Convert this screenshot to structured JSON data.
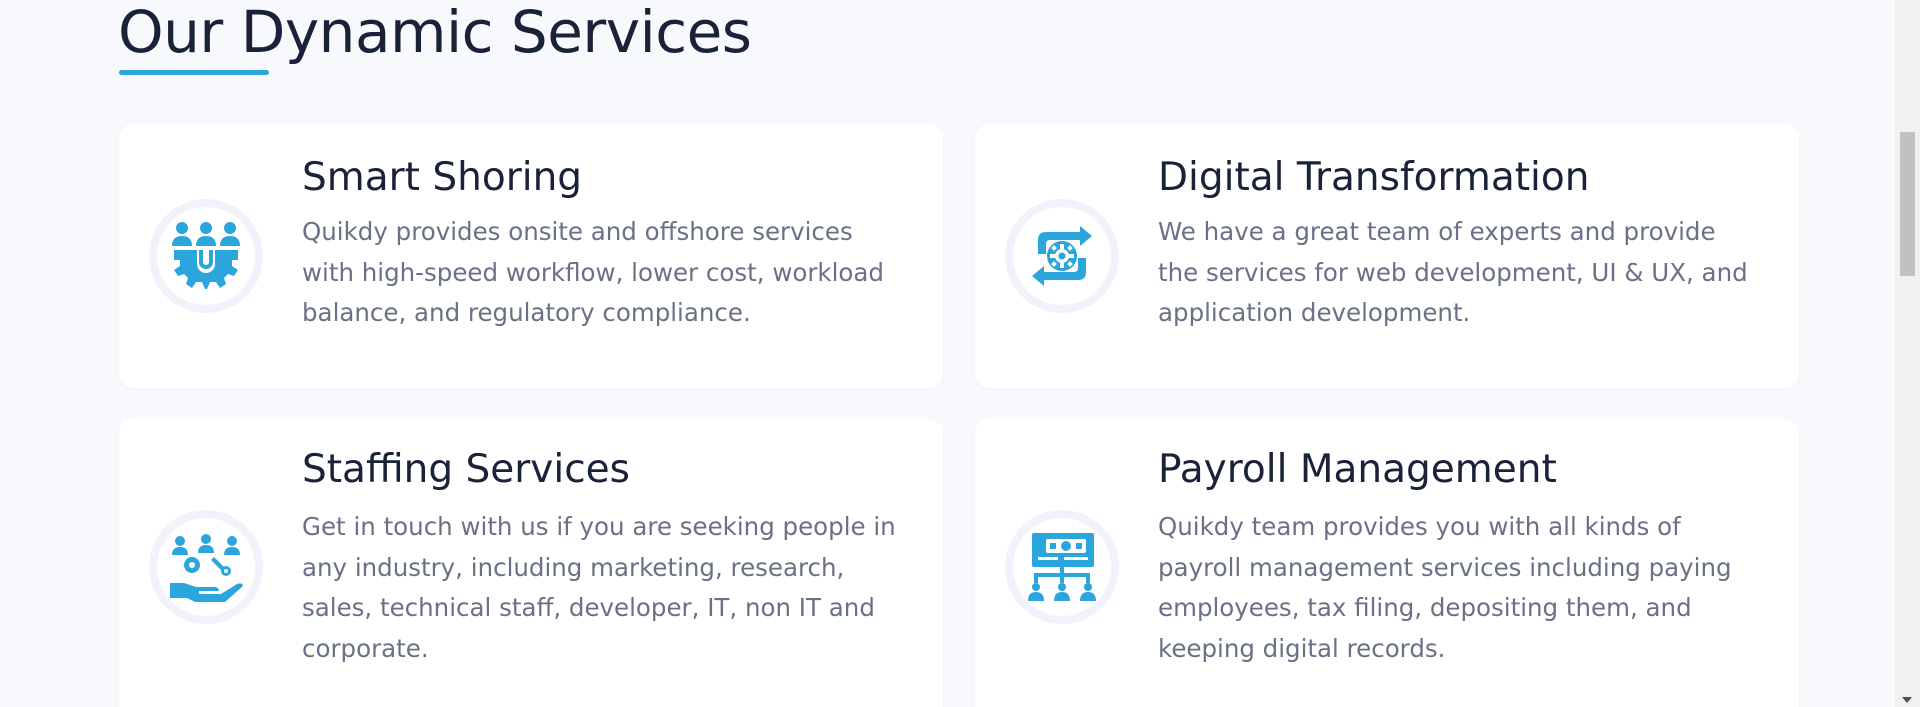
{
  "section": {
    "heading": "Our Dynamic Services"
  },
  "colors": {
    "accent": "#2aa6dc",
    "heading": "#1a2239",
    "body_text": "#6a7186",
    "background": "#f8f9fd",
    "card": "#ffffff"
  },
  "services": [
    {
      "title": "Smart Shoring",
      "description": "Quikdy provides onsite and offshore services with high-speed workflow, lower cost, workload balance, and regulatory compliance.",
      "icon": "team-gear-icon"
    },
    {
      "title": "Digital Transformation",
      "description": "We have a great team of experts and provide the services for web development, UI & UX, and application development.",
      "icon": "transform-gear-icon"
    },
    {
      "title": "Staffing Services",
      "description": "Get in touch with us if you are seeking people in any industry, including marketing, research, sales, technical staff, developer, IT, non IT and corporate.",
      "icon": "hand-people-icon"
    },
    {
      "title": "Payroll Management",
      "description": "Quikdy team provides you with all kinds of payroll management services including paying employees, tax filing, depositing them, and keeping digital records.",
      "icon": "payroll-board-icon"
    }
  ]
}
